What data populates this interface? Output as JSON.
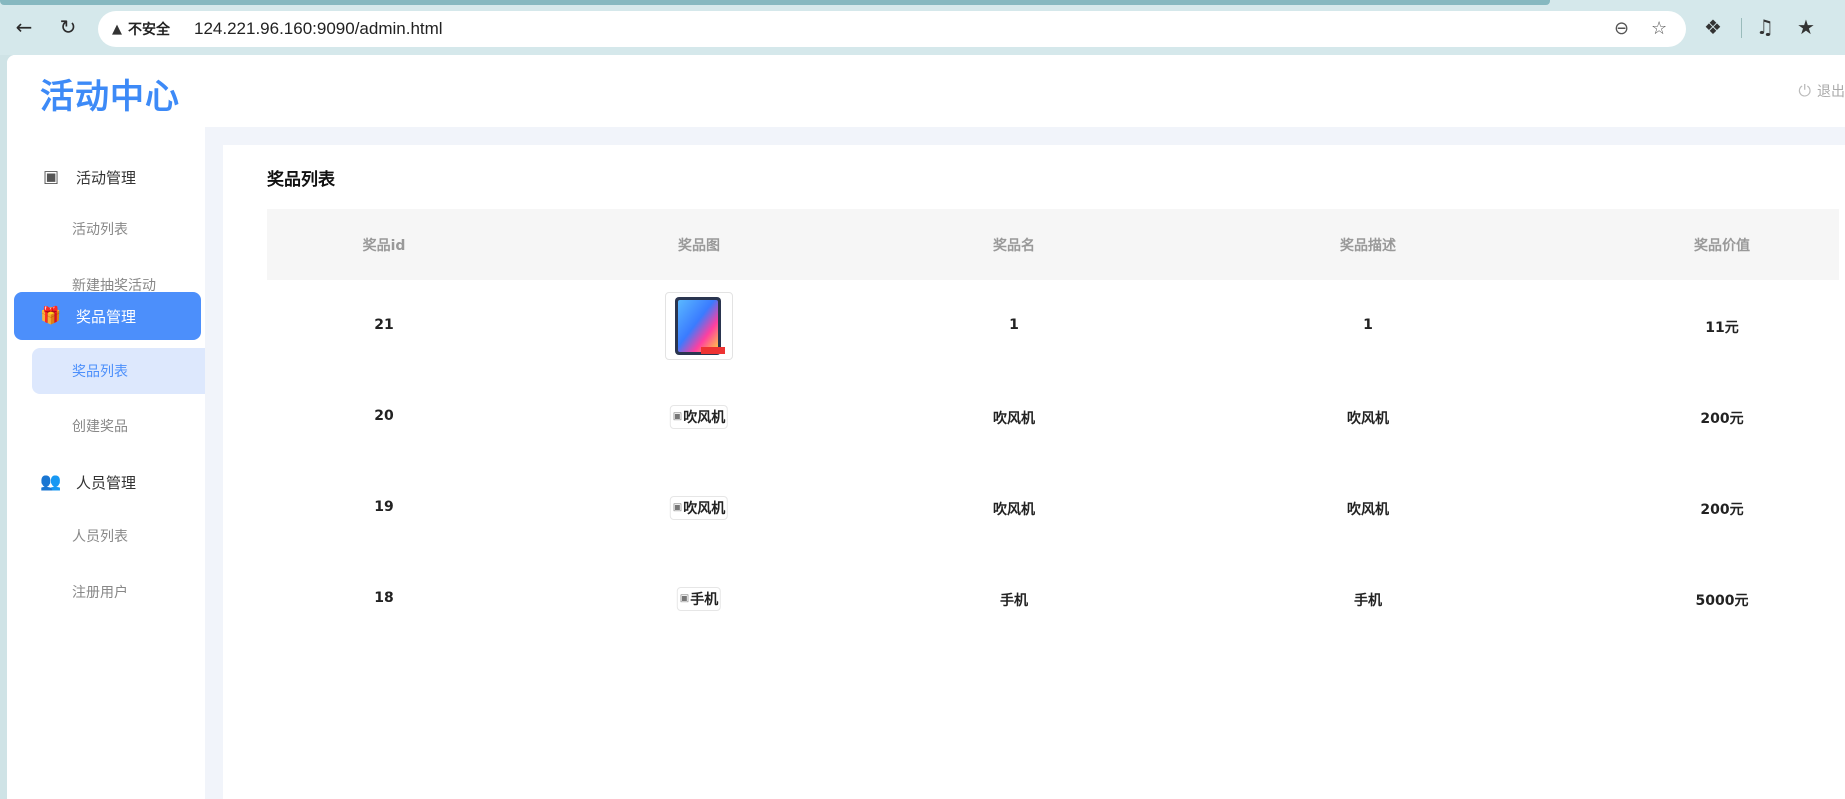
{
  "browser": {
    "security_label": "不安全",
    "url": "124.221.96.160:9090/admin.html"
  },
  "header": {
    "logo": "活动中心",
    "logout_label": "退出"
  },
  "sidebar": {
    "groups": [
      {
        "label": "活动管理",
        "icon": "cube-icon",
        "items": [
          "活动列表",
          "新建抽奖活动"
        ]
      },
      {
        "label": "奖品管理",
        "icon": "gift-icon",
        "items": [
          "奖品列表",
          "创建奖品"
        ]
      },
      {
        "label": "人员管理",
        "icon": "users-icon",
        "items": [
          "人员列表",
          "注册用户"
        ]
      }
    ],
    "active_group": "奖品管理",
    "active_item": "奖品列表"
  },
  "main": {
    "title": "奖品列表",
    "columns": [
      "奖品id",
      "奖品图",
      "奖品名",
      "奖品描述",
      "奖品价值"
    ],
    "rows": [
      {
        "id": "21",
        "image_alt": "",
        "image_loaded": true,
        "name": "1",
        "desc": "1",
        "value": "11元"
      },
      {
        "id": "20",
        "image_alt": "吹风机",
        "image_loaded": false,
        "name": "吹风机",
        "desc": "吹风机",
        "value": "200元"
      },
      {
        "id": "19",
        "image_alt": "吹风机",
        "image_loaded": false,
        "name": "吹风机",
        "desc": "吹风机",
        "value": "200元"
      },
      {
        "id": "18",
        "image_alt": "手机",
        "image_loaded": false,
        "name": "手机",
        "desc": "手机",
        "value": "5000元"
      }
    ]
  },
  "colors": {
    "accent": "#4c8ffb",
    "accent_light": "#dde8fd",
    "logo": "#3d8af7",
    "header_bg": "#f6f6f6"
  }
}
